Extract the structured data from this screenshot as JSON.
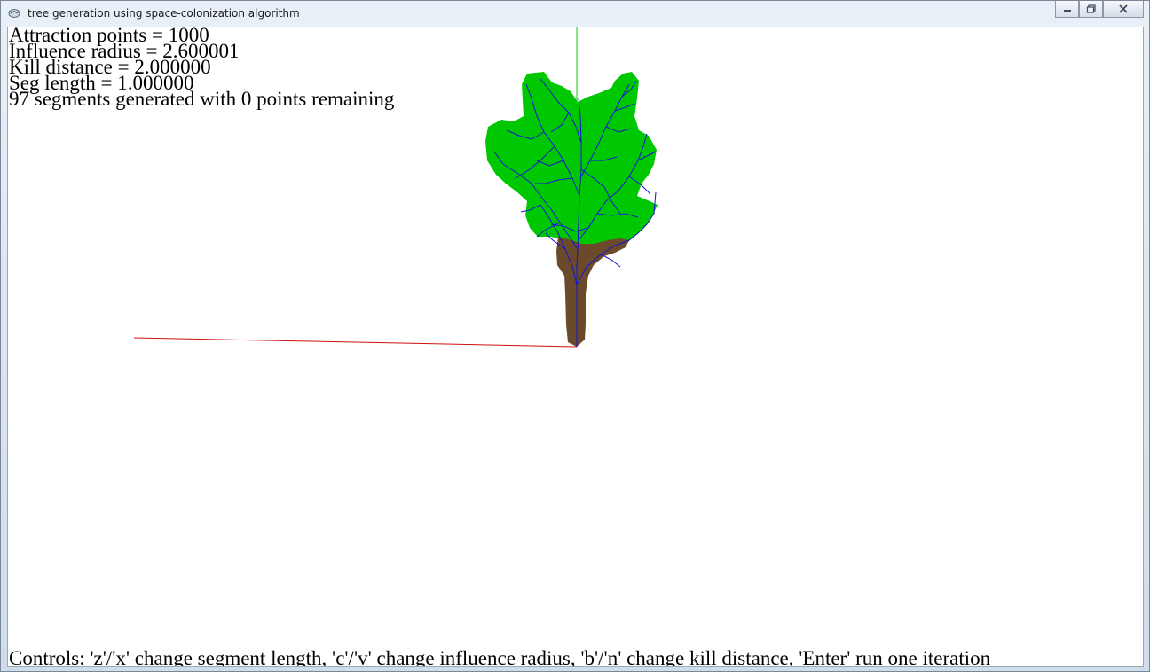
{
  "window": {
    "title": "tree generation using space-colonization algorithm",
    "controls": {
      "minimize": "minimize-icon",
      "maximize": "restore-icon",
      "close": "close-icon"
    }
  },
  "info": {
    "attraction_points": "Attraction points = 1000",
    "influence_radius": "Influence radius = 2.600001",
    "kill_distance": "Kill distance = 2.000000",
    "seg_length": "Seg length = 1.000000",
    "status": "97 segments generated with 0 points remaining"
  },
  "controls_help": "Controls: 'z'/'x' change segment length, 'c'/'v' change influence radius, 'b'/'n' change kill distance, 'Enter' run one iteration",
  "colors": {
    "foliage": "#00c800",
    "trunk": "#6b4a2b",
    "branches": "#1414d2",
    "x_axis": "#d01010",
    "y_axis": "#10c810"
  }
}
